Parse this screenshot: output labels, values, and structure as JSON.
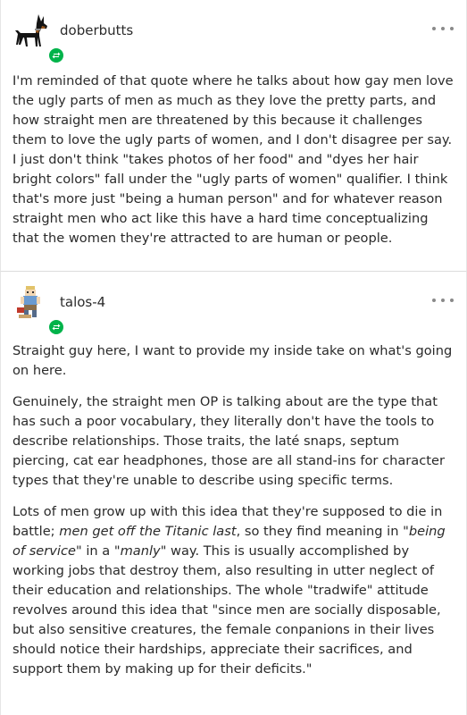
{
  "posts": [
    {
      "username": "doberbutts",
      "avatar_icon": "doberman-dog-icon",
      "paragraphs": [
        "I'm reminded of that quote where he talks about how gay men love the ugly parts of men as much as they love the pretty parts, and how straight men are threatened by this because it challenges them to love the ugly parts of women, and I don't disagree per say. I just don't think \"takes photos of her food\" and \"dyes her hair bright colors\" fall under the \"ugly parts of women\" qualifier. I think that's more just \"being a human person\" and for whatever reason straight men who act like this have a hard time conceptualizing that the women they're attracted to are human or people."
      ]
    },
    {
      "username": "talos-4",
      "avatar_icon": "pixel-figure-icon",
      "paragraphs": [
        "Straight guy here, I want to provide my inside take on what's going on here.",
        "Genuinely, the straight men OP is talking about are the type that has such a poor vocabulary, they literally don't have the tools to describe relationships. Those traits, the laté snaps, septum piercing, cat ear headphones, those are all stand-ins for character types that they're unable to describe using specific terms."
      ],
      "para3": {
        "t1": "Lots of men grow up with this idea that they're supposed to die in battle; ",
        "t2": "men get off the Titanic last",
        "t3": ", so they find meaning in \"",
        "t4": "being of service",
        "t5": "\" in a \"",
        "t6": "manly",
        "t7": "\" way. This is usually accomplished by working jobs that destroy them, also resulting in utter neglect of their education and relationships. The whole \"tradwife\" attitude revolves around this idea that \"since men are socially disposable, but also sensitive creatures, the female conpanions in their lives should notice their hardships, appreciate their sacrifices, and support them by making up for their deficits.\""
      }
    }
  ],
  "colors": {
    "reblog_badge": "#00b34a",
    "text": "#2a2a2a",
    "divider": "#dcdcdc"
  }
}
